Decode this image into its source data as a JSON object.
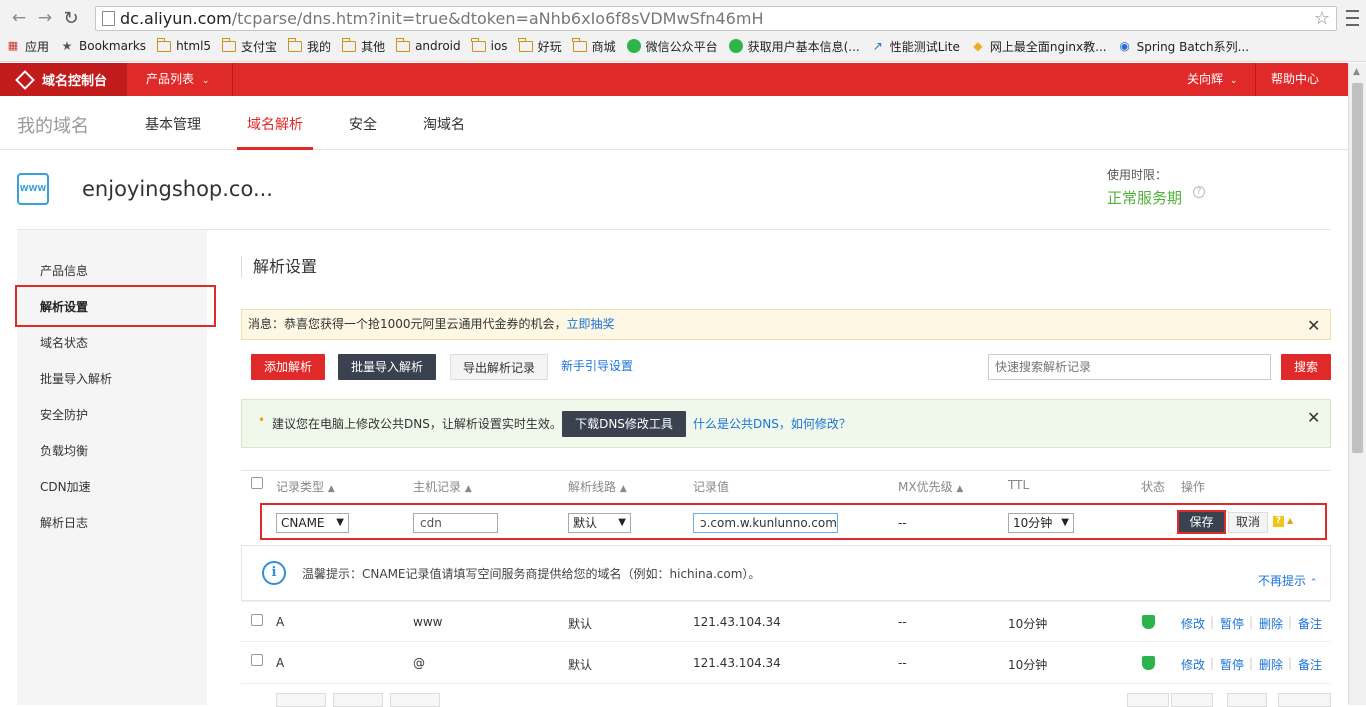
{
  "browser": {
    "url_host": "dc.aliyun.com",
    "url_rest": "/tcparse/dns.htm?init=true&dtoken=aNhb6xIo6f8sVDMwSfn46mH",
    "bookmarks": [
      "应用",
      "Bookmarks",
      "html5",
      "支付宝",
      "我的",
      "其他",
      "android",
      "ios",
      "好玩",
      "商城",
      "微信公众平台",
      "获取用户基本信息(...",
      "性能测试Lite",
      "网上最全面nginx教...",
      "Spring Batch系列..."
    ]
  },
  "topbar": {
    "brand": "域名控制台",
    "product_list": "产品列表",
    "user": "关向辉",
    "help": "帮助中心"
  },
  "subnav": {
    "title": "我的域名",
    "tabs": [
      "基本管理",
      "域名解析",
      "安全",
      "淘域名"
    ],
    "active_tab": "域名解析"
  },
  "domain": {
    "name": "enjoyingshop.co...",
    "icon_text": "WWW",
    "valid_label": "使用时限：",
    "valid_value": "正常服务期"
  },
  "sidebar": {
    "items": [
      "产品信息",
      "解析设置",
      "域名状态",
      "批量导入解析",
      "安全防护",
      "负载均衡",
      "CDN加速",
      "解析日志"
    ],
    "active": "解析设置"
  },
  "main": {
    "section_title": "解析设置",
    "notice_text": "消息：恭喜您获得一个抢1000元阿里云通用代金券的机会，",
    "notice_link": "立即抽奖",
    "buttons": {
      "add": "添加解析",
      "batch_import": "批量导入解析",
      "export": "导出解析记录",
      "guide": "新手引导设置",
      "search": "搜索"
    },
    "search_placeholder": "快速搜索解析记录",
    "dns_tip": "建议您在电脑上修改公共DNS，让解析设置实时生效。",
    "dns_button": "下载DNS修改工具",
    "dns_link": "什么是公共DNS，如何修改？"
  },
  "table": {
    "headers": [
      "记录类型",
      "主机记录",
      "解析线路",
      "记录值",
      "MX优先级",
      "TTL",
      "状态",
      "操作"
    ],
    "edit_row": {
      "type": "CNAME",
      "host": "cdn",
      "line": "默认",
      "value": "ɔ.com.w.kunlunno.com",
      "mx": "--",
      "ttl": "10分钟",
      "save": "保存",
      "cancel": "取消"
    },
    "tip": {
      "text": "温馨提示：CNAME记录值请填写空间服务商提供给您的域名（例如：hichina.com）。",
      "hide": "不再提示"
    },
    "rows": [
      {
        "type": "A",
        "host": "www",
        "line": "默认",
        "value": "121.43.104.34",
        "mx": "--",
        "ttl": "10分钟",
        "actions": [
          "修改",
          "暂停",
          "删除",
          "备注"
        ]
      },
      {
        "type": "A",
        "host": "@",
        "line": "默认",
        "value": "121.43.104.34",
        "mx": "--",
        "ttl": "10分钟",
        "actions": [
          "修改",
          "暂停",
          "删除",
          "备注"
        ]
      }
    ]
  }
}
